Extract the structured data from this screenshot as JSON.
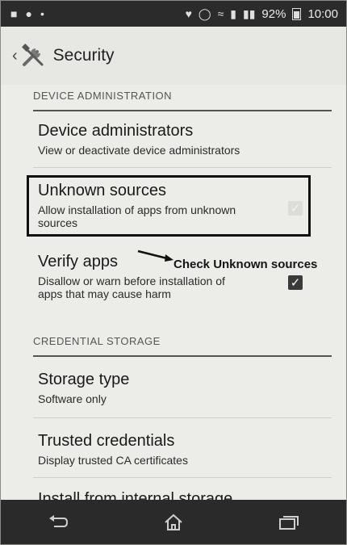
{
  "status_bar": {
    "network": "92%",
    "time": "10:00"
  },
  "action_bar": {
    "title": "Security"
  },
  "sections": {
    "device_admin": {
      "header": "DEVICE ADMINISTRATION"
    },
    "credential": {
      "header": "CREDENTIAL STORAGE"
    }
  },
  "prefs": {
    "device_admins": {
      "title": "Device administrators",
      "summary": "View or deactivate device administrators"
    },
    "unknown_sources": {
      "title": "Unknown sources",
      "summary": "Allow installation of apps from unknown sources",
      "checked": false
    },
    "verify_apps": {
      "title": "Verify apps",
      "summary": "Disallow or warn before installation of apps that may cause harm",
      "checked": true
    },
    "storage_type": {
      "title": "Storage type",
      "summary": "Software only"
    },
    "trusted_credentials": {
      "title": "Trusted credentials",
      "summary": "Display trusted CA certificates"
    },
    "install_storage": {
      "title": "Install from internal storage"
    }
  },
  "annotation": {
    "text": "Check Unknown sources"
  },
  "icons": {
    "back": "chevron-left-icon",
    "app": "tools-icon",
    "nav_back": "back-icon",
    "nav_home": "home-icon",
    "nav_recents": "recents-icon"
  },
  "colors": {
    "status_bar": "#2b2b2b",
    "nav_bar": "#2a2a2a",
    "background": "#ecece8"
  }
}
